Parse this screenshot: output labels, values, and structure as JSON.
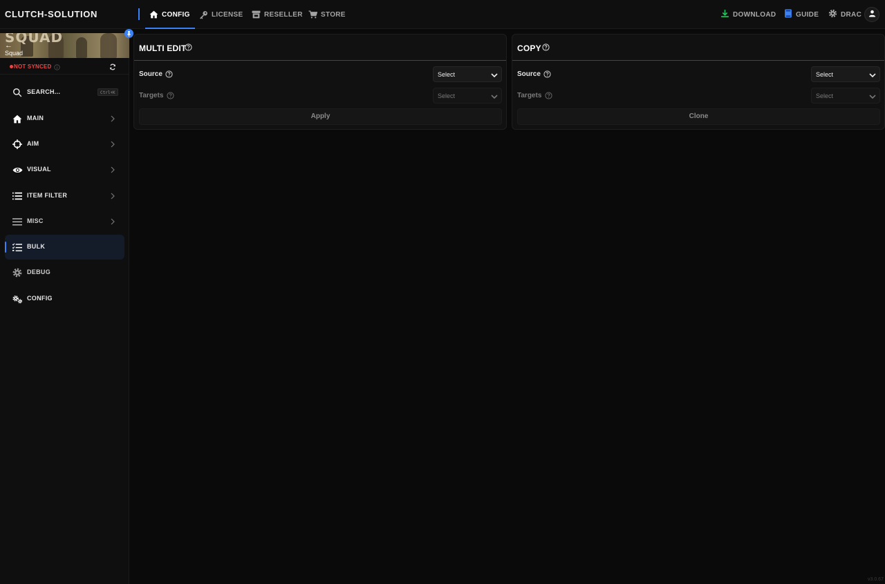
{
  "app": {
    "brand": "CLUTCH-SOLUTION",
    "version": "v3.0.67"
  },
  "topnav": {
    "items": [
      {
        "label": "CONFIG",
        "icon": "home-icon",
        "active": true
      },
      {
        "label": "LICENSE",
        "icon": "key-icon",
        "active": false
      },
      {
        "label": "RESELLER",
        "icon": "store-icon",
        "active": false
      },
      {
        "label": "STORE",
        "icon": "cart-icon",
        "active": false
      }
    ],
    "right": {
      "download": "DOWNLOAD",
      "guide": "GUIDE",
      "user": "DRAC"
    }
  },
  "sidebar": {
    "game": {
      "logo_text": "SQUAD",
      "back": "←",
      "name": "Squad"
    },
    "sync": {
      "status": "NOT SYNCED"
    },
    "search": {
      "label": "SEARCH...",
      "shortcut": "Ctrl+K"
    },
    "items": [
      {
        "label": "MAIN",
        "icon": "home-icon"
      },
      {
        "label": "AIM",
        "icon": "crosshair-icon"
      },
      {
        "label": "VISUAL",
        "icon": "eye-icon"
      },
      {
        "label": "ITEM FILTER",
        "icon": "list-icon"
      },
      {
        "label": "MISC",
        "icon": "menu-icon"
      },
      {
        "label": "BULK",
        "icon": "checklist-icon"
      },
      {
        "label": "DEBUG",
        "icon": "gear-icon"
      },
      {
        "label": "CONFIG",
        "icon": "gears-icon"
      }
    ]
  },
  "multi_edit": {
    "title": "MULTI EDIT",
    "source_label": "Source",
    "source_value": "Select",
    "targets_label": "Targets",
    "targets_value": "Select",
    "action": "Apply"
  },
  "copy": {
    "title": "COPY",
    "source_label": "Source",
    "source_value": "Select",
    "targets_label": "Targets",
    "targets_value": "Select",
    "action": "Clone"
  },
  "colors": {
    "accent": "#3b82f6",
    "danger": "#ef4444",
    "download": "#22c55e",
    "background": "#0a0a0a"
  }
}
